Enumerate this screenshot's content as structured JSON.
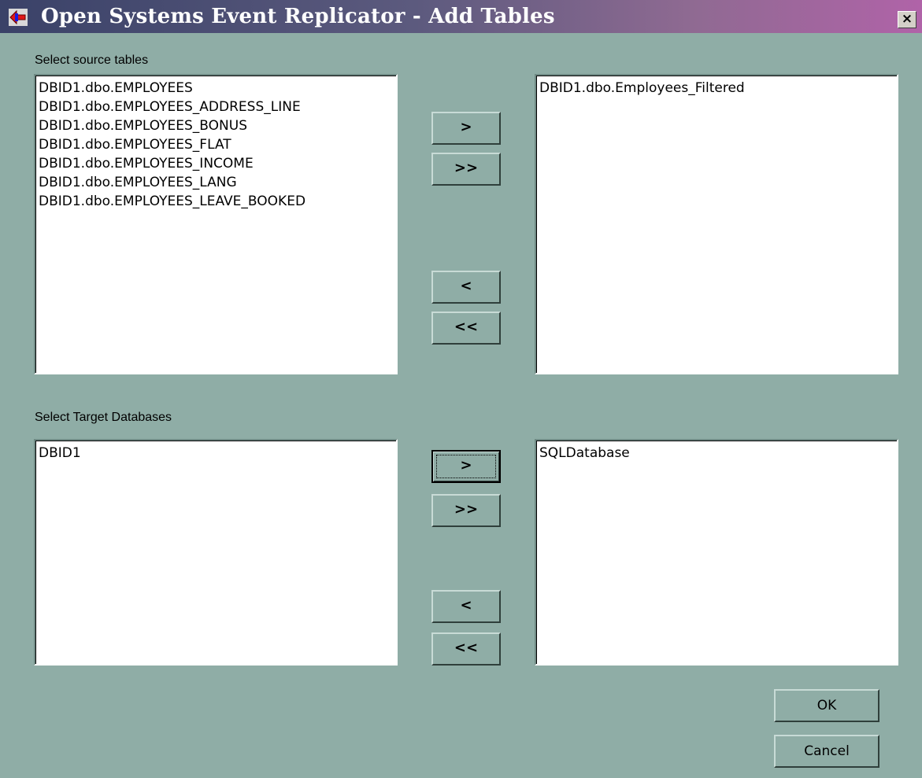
{
  "window": {
    "title": "Open Systems Event Replicator - Add Tables",
    "close_glyph": "×"
  },
  "source_tables": {
    "label": "Select source tables",
    "available": [
      "DBID1.dbo.EMPLOYEES",
      "DBID1.dbo.EMPLOYEES_ADDRESS_LINE",
      "DBID1.dbo.EMPLOYEES_BONUS",
      "DBID1.dbo.EMPLOYEES_FLAT",
      "DBID1.dbo.EMPLOYEES_INCOME",
      "DBID1.dbo.EMPLOYEES_LANG",
      "DBID1.dbo.EMPLOYEES_LEAVE_BOOKED"
    ],
    "selected": [
      "DBID1.dbo.Employees_Filtered"
    ],
    "buttons": {
      "add": ">",
      "add_all": ">>",
      "remove": "<",
      "remove_all": "<<"
    }
  },
  "target_databases": {
    "label": "Select Target Databases",
    "available": [
      "DBID1"
    ],
    "selected": [
      "SQLDatabase"
    ],
    "buttons": {
      "add": ">",
      "add_all": ">>",
      "remove": "<",
      "remove_all": "<<"
    }
  },
  "dialog_buttons": {
    "ok": "OK",
    "cancel": "Cancel"
  }
}
